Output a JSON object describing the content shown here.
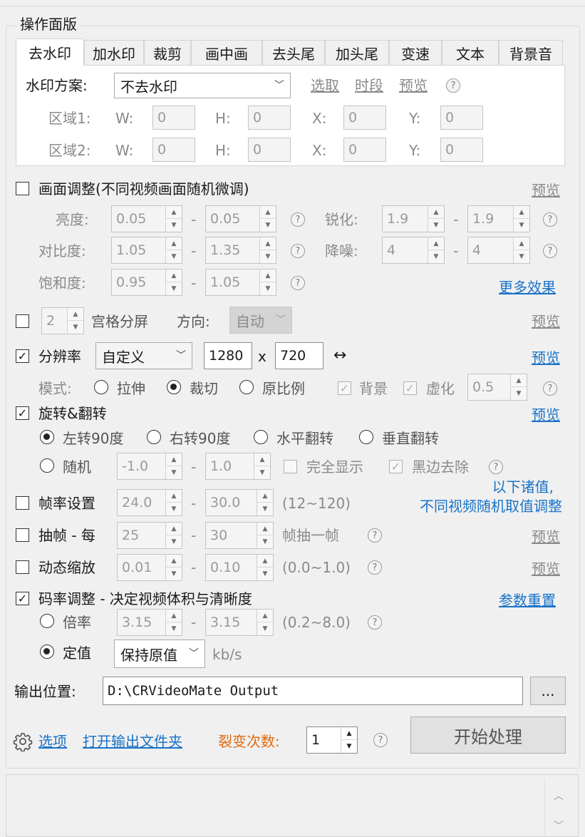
{
  "panel_title": "操作面版",
  "tabs": [
    "去水印",
    "加水印",
    "裁剪",
    "画中画",
    "去头尾",
    "加头尾",
    "变速",
    "文本",
    "背景音"
  ],
  "watermark": {
    "scheme_label": "水印方案:",
    "scheme_value": "不去水印",
    "links": [
      "选取",
      "时段",
      "预览"
    ],
    "regions": [
      {
        "label": "区域1:",
        "w": "0",
        "h": "0",
        "x": "0",
        "y": "0"
      },
      {
        "label": "区域2:",
        "w": "0",
        "h": "0",
        "x": "0",
        "y": "0"
      }
    ],
    "w_label": "W:",
    "h_label": "H:",
    "x_label": "X:",
    "y_label": "Y:"
  },
  "picture_adjust": {
    "label": "画面调整(不同视频画面随机微调)",
    "preview": "预览",
    "brightness_label": "亮度:",
    "brightness_min": "0.05",
    "brightness_max": "0.05",
    "contrast_label": "对比度:",
    "contrast_min": "1.05",
    "contrast_max": "1.35",
    "saturation_label": "饱和度:",
    "saturation_min": "0.95",
    "saturation_max": "1.05",
    "sharpen_label": "锐化:",
    "sharpen_min": "1.9",
    "sharpen_max": "1.9",
    "denoise_label": "降噪:",
    "denoise_min": "4",
    "denoise_max": "4",
    "more_effects": "更多效果",
    "dash": "-"
  },
  "grid_split": {
    "count": "2",
    "label": "宫格分屏",
    "direction_label": "方向:",
    "direction_value": "自动",
    "preview": "预览"
  },
  "resolution": {
    "label": "分辨率",
    "preset": "自定义",
    "width": "1280",
    "x": "x",
    "height": "720",
    "swap": "↔",
    "preview": "预览",
    "mode_label": "模式:",
    "modes": [
      "拉伸",
      "裁切",
      "原比例"
    ],
    "background_label": "背景",
    "blur_label": "虚化",
    "blur_value": "0.5"
  },
  "rotate": {
    "label": "旋转&翻转",
    "preview": "预览",
    "options": [
      "左转90度",
      "右转90度",
      "水平翻转",
      "垂直翻转"
    ],
    "random_label": "随机",
    "random_min": "-1.0",
    "random_max": "1.0",
    "full_display": "完全显示",
    "remove_black": "黑边去除"
  },
  "note": [
    "以下诸值,",
    "不同视频随机取值调整"
  ],
  "framerate": {
    "label": "帧率设置",
    "min": "24.0",
    "max": "30.0",
    "range": "(12~120)"
  },
  "frame_drop": {
    "label": "抽帧 - 每",
    "min": "25",
    "max": "30",
    "suffix": "帧抽一帧",
    "preview": "预览"
  },
  "dynamic_zoom": {
    "label": "动态缩放",
    "min": "0.01",
    "max": "0.10",
    "range": "(0.0~1.0)",
    "preview": "预览"
  },
  "bitrate": {
    "label": "码率调整 - 决定视频体积与清晰度",
    "reset": "参数重置",
    "ratio_label": "倍率",
    "ratio_min": "3.15",
    "ratio_max": "3.15",
    "ratio_range": "(0.2~8.0)",
    "fixed_label": "定值",
    "fixed_value": "保持原值",
    "unit": "kb/s"
  },
  "output": {
    "label": "输出位置:",
    "path": "D:\\CRVideoMate Output",
    "browse": "..."
  },
  "footer": {
    "options": "选项",
    "open_folder": "打开输出文件夹",
    "fission_label": "裂变次数:",
    "fission_value": "1",
    "start": "开始处理"
  },
  "colors": {
    "link": "#1a73c8",
    "accent_orange": "#e06a10"
  }
}
